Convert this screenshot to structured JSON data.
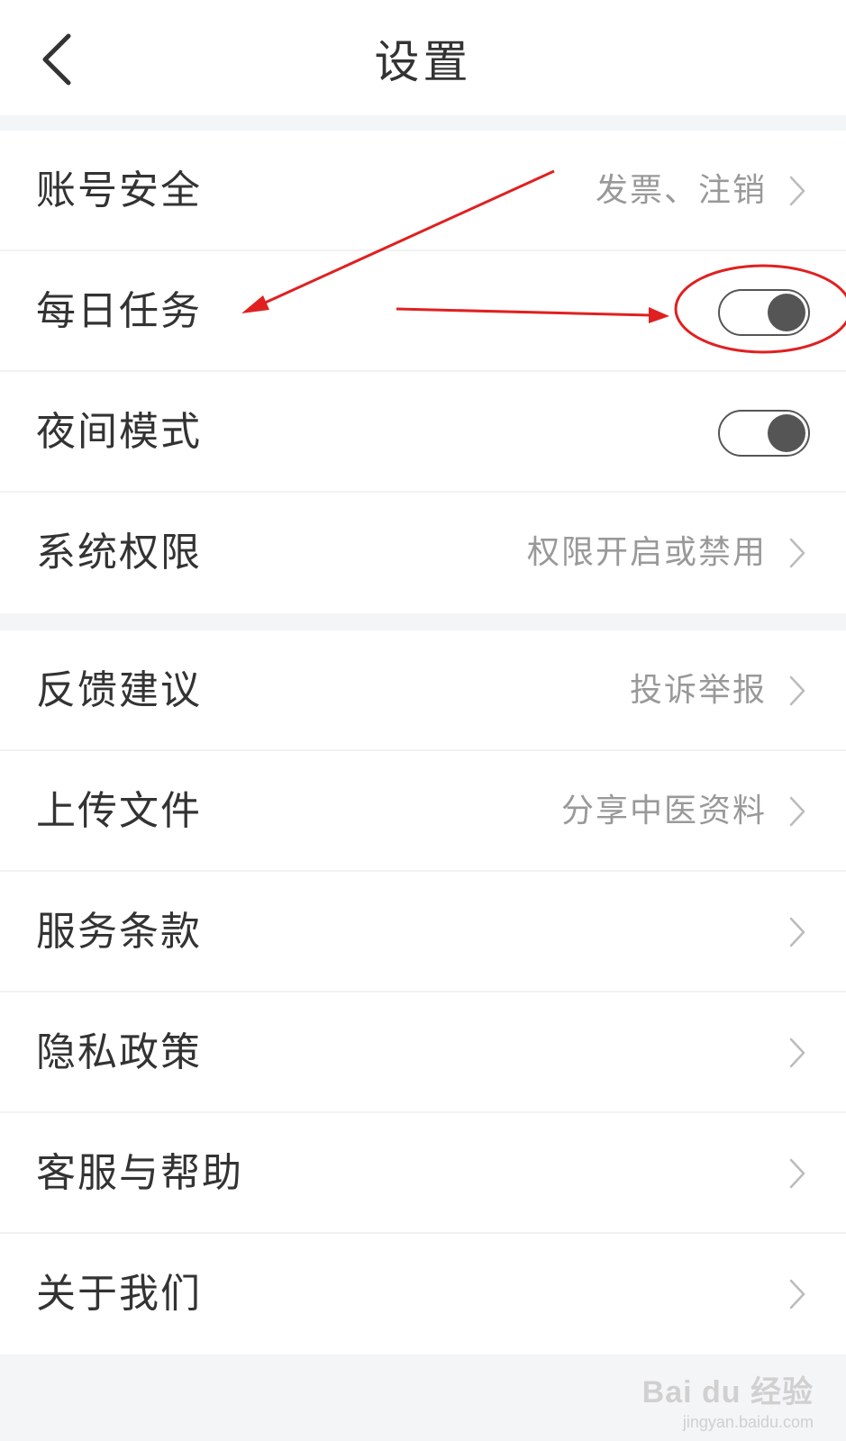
{
  "header": {
    "title": "设置",
    "back_icon": "chevron-left-icon"
  },
  "sections": [
    {
      "items": [
        {
          "label": "账号安全",
          "value": "发票、注销",
          "control": "chevron"
        },
        {
          "label": "每日任务",
          "control": "toggle",
          "on": false
        },
        {
          "label": "夜间模式",
          "control": "toggle",
          "on": false
        },
        {
          "label": "系统权限",
          "value": "权限开启或禁用",
          "control": "chevron"
        }
      ]
    },
    {
      "items": [
        {
          "label": "反馈建议",
          "value": "投诉举报",
          "control": "chevron"
        },
        {
          "label": "上传文件",
          "value": "分享中医资料",
          "control": "chevron"
        },
        {
          "label": "服务条款",
          "control": "chevron"
        },
        {
          "label": "隐私政策",
          "control": "chevron"
        },
        {
          "label": "客服与帮助",
          "control": "chevron"
        },
        {
          "label": "关于我们",
          "control": "chevron"
        }
      ]
    }
  ],
  "annotation": {
    "color": "#e02020"
  },
  "watermark": {
    "brand": "Bai du 经验",
    "url": "jingyan.baidu.com"
  },
  "colors": {
    "text": "#333333",
    "secondary": "#999999",
    "divider": "#f1f2f3",
    "background": "#f4f5f6",
    "toggle": "#555555"
  }
}
